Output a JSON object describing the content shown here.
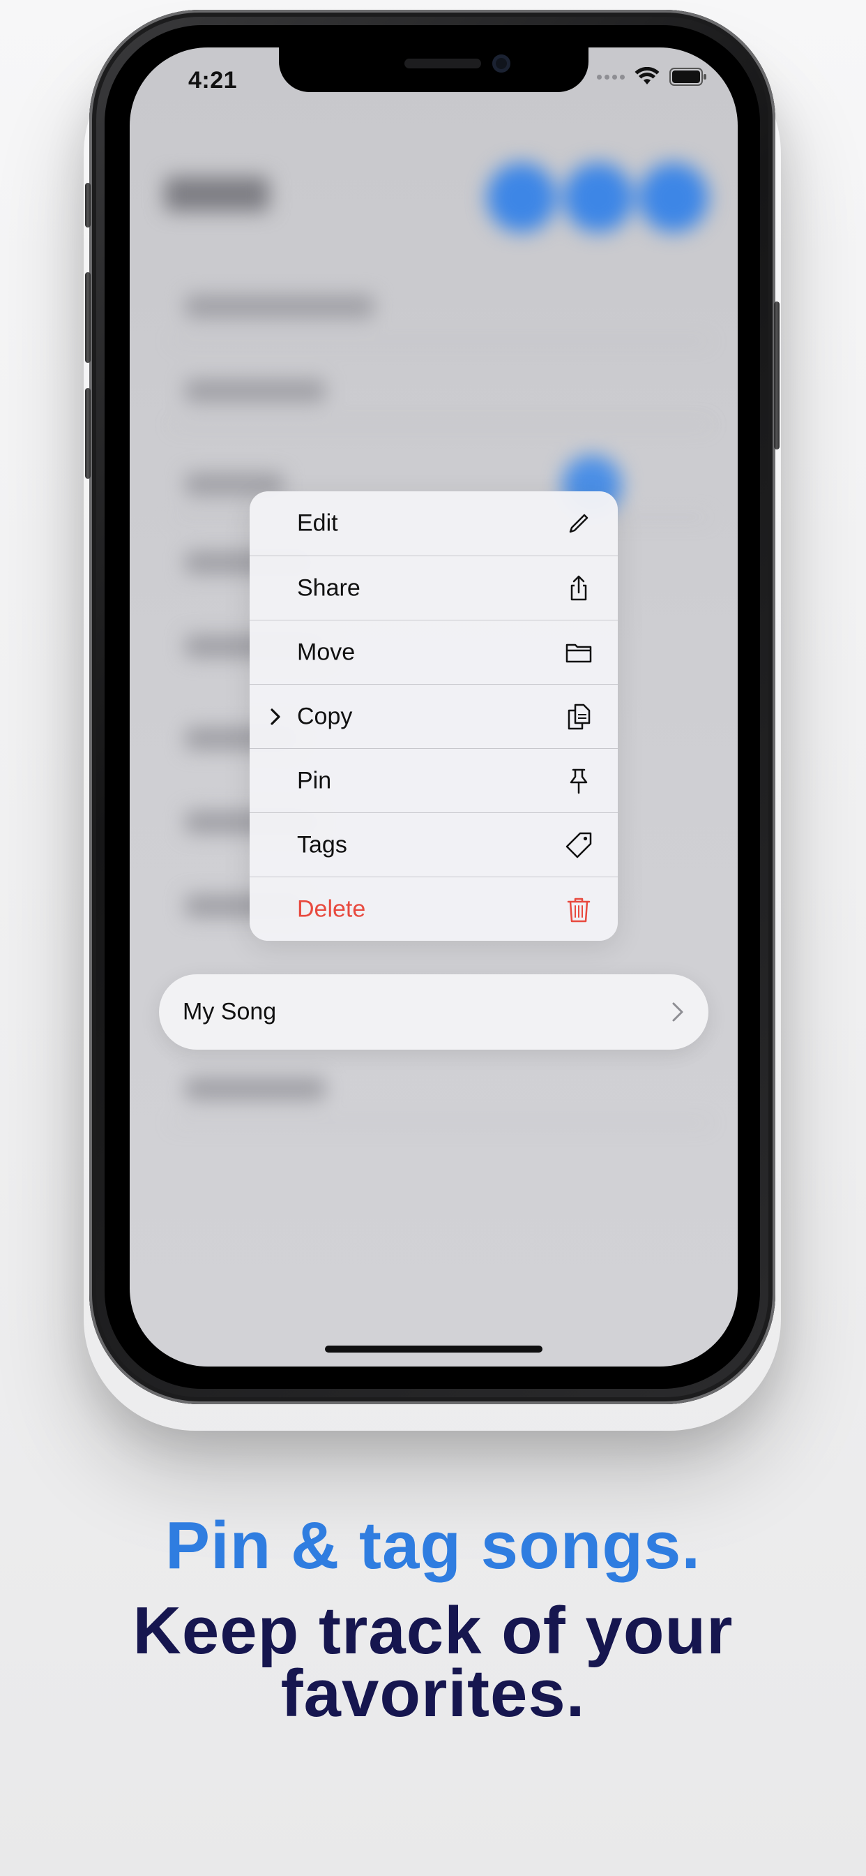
{
  "status_bar": {
    "time": "4:21"
  },
  "context_menu": {
    "items": [
      {
        "label": "Edit",
        "icon": "pencil-icon",
        "has_submenu": false,
        "destructive": false
      },
      {
        "label": "Share",
        "icon": "share-icon",
        "has_submenu": false,
        "destructive": false
      },
      {
        "label": "Move",
        "icon": "folder-icon",
        "has_submenu": false,
        "destructive": false
      },
      {
        "label": "Copy",
        "icon": "copy-icon",
        "has_submenu": true,
        "destructive": false
      },
      {
        "label": "Pin",
        "icon": "pin-icon",
        "has_submenu": false,
        "destructive": false
      },
      {
        "label": "Tags",
        "icon": "tag-icon",
        "has_submenu": false,
        "destructive": false
      },
      {
        "label": "Delete",
        "icon": "trash-icon",
        "has_submenu": false,
        "destructive": true
      }
    ]
  },
  "selected_row": {
    "label": "My Song"
  },
  "caption": {
    "headline": "Pin & tag songs.",
    "subline": "Keep track of your favorites."
  },
  "colors": {
    "accent_blue": "#2f7de0",
    "headline_navy": "#16164f",
    "destructive_red": "#e84a3f"
  }
}
